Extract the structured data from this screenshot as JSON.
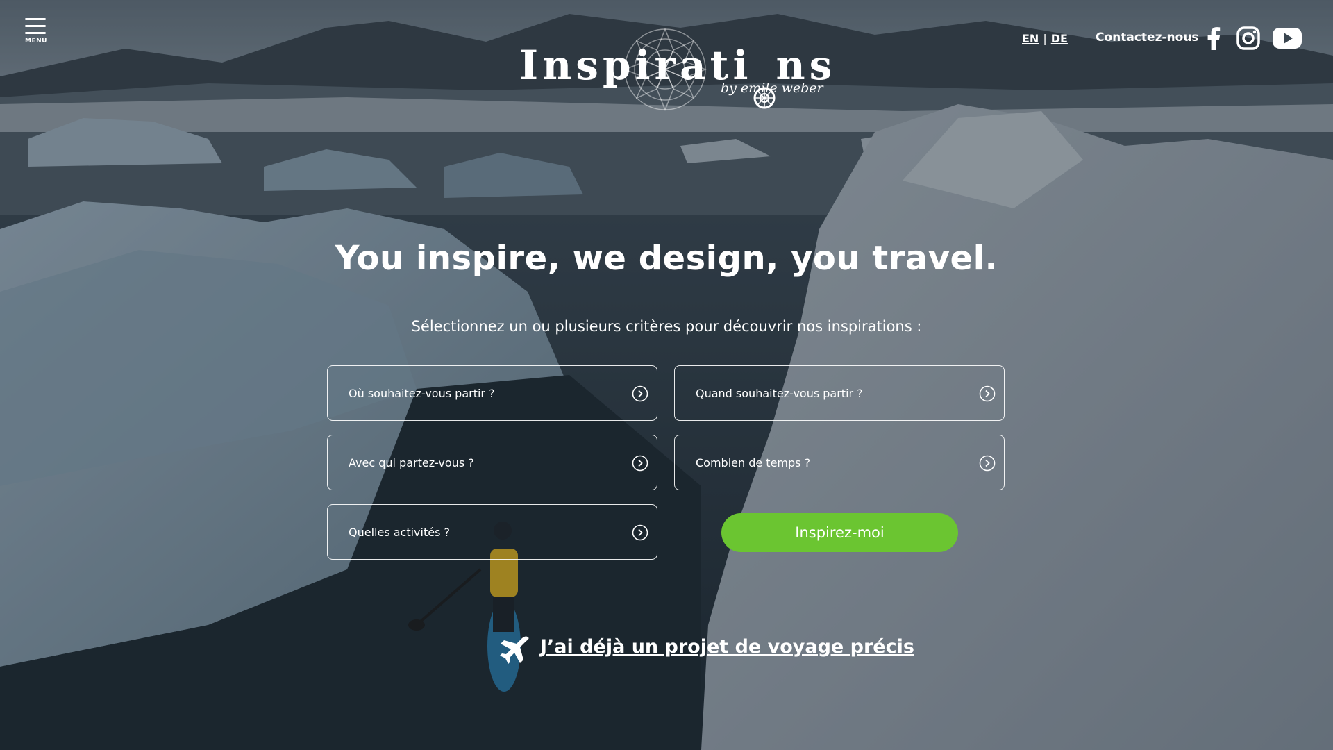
{
  "header": {
    "menu_label": "MENU",
    "logo": {
      "word_before": "Inspirati",
      "word_after": "ns",
      "byline": "by emile weber"
    },
    "languages": [
      "EN",
      "DE"
    ],
    "lang_separator": "|",
    "contact_label": "Contactez-nous",
    "social": [
      "facebook-icon",
      "instagram-icon",
      "youtube-icon"
    ]
  },
  "hero": {
    "headline": "You inspire, we design, you travel.",
    "subline": "Sélectionnez un ou plusieurs critères pour découvrir nos inspirations :"
  },
  "criteria": [
    {
      "label": "Où souhaitez-vous partir ?"
    },
    {
      "label": "Quand souhaitez-vous partir ?"
    },
    {
      "label": "Avec qui partez-vous ?"
    },
    {
      "label": "Combien de temps ?"
    },
    {
      "label": "Quelles activités ?"
    }
  ],
  "cta": {
    "inspire_label": "Inspirez-moi",
    "project_label": "J’ai déjà un projet de voyage précis"
  },
  "colors": {
    "accent_green": "#6bc531",
    "text": "#ffffff"
  }
}
